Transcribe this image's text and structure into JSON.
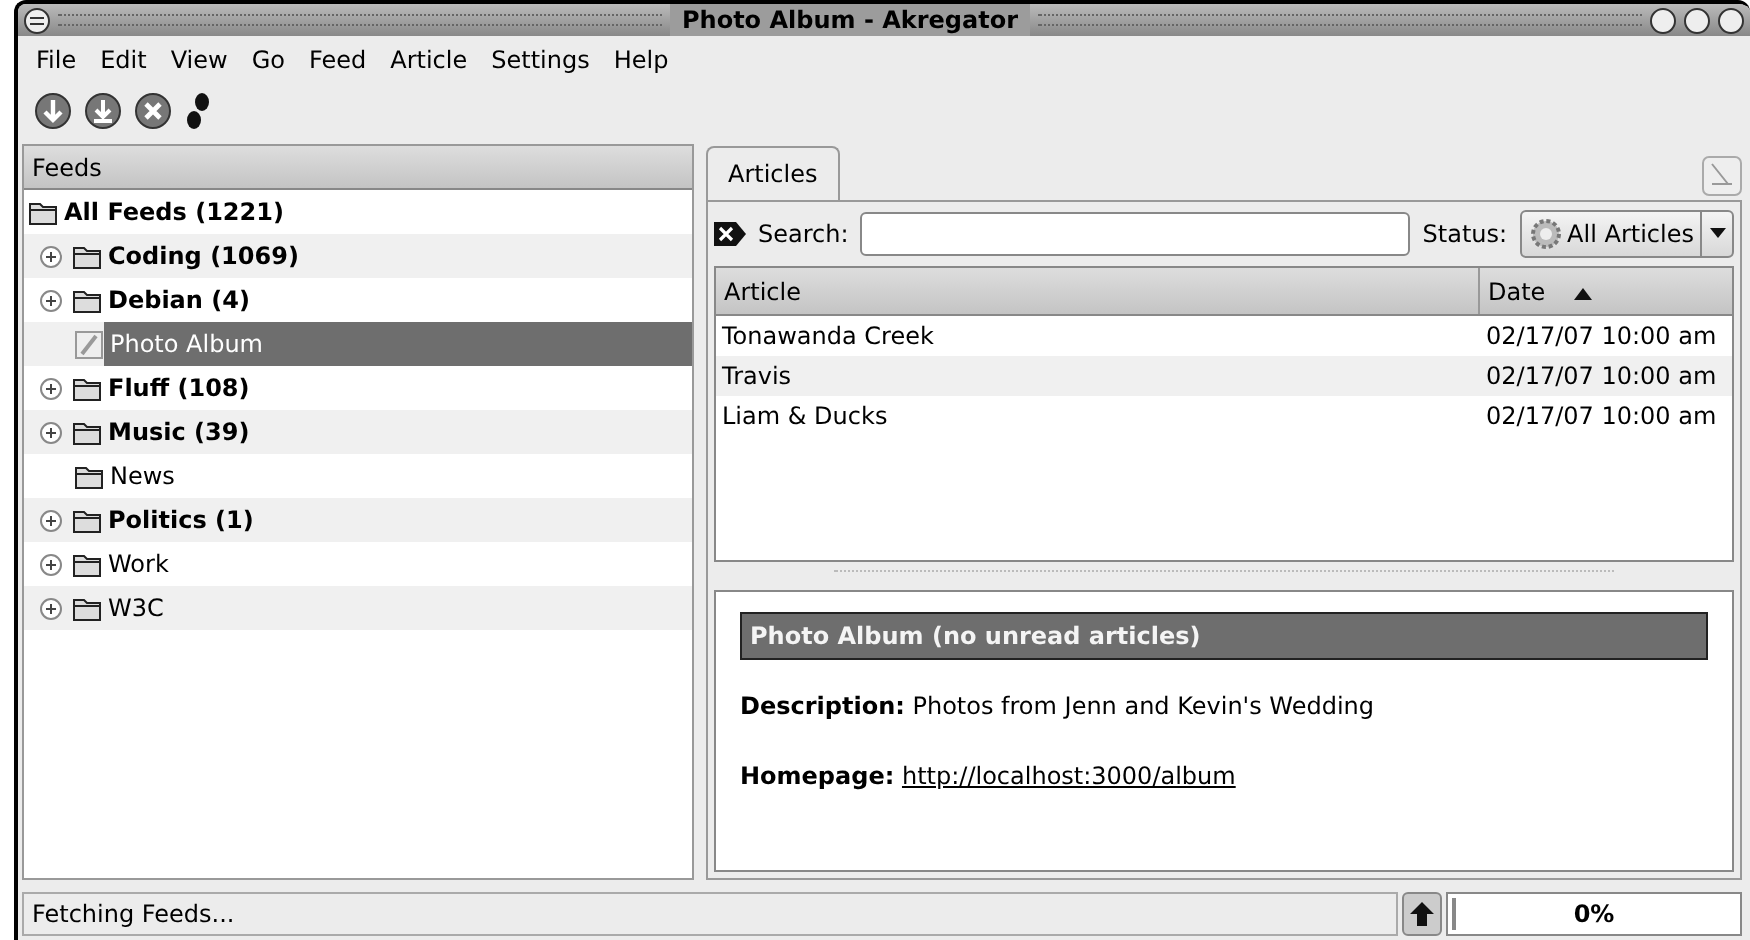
{
  "window": {
    "title": "Photo Album - Akregator"
  },
  "menu": [
    "File",
    "Edit",
    "View",
    "Go",
    "Feed",
    "Article",
    "Settings",
    "Help"
  ],
  "feeds": {
    "title": "Feeds",
    "tree": {
      "label": "All Feeds (1221)",
      "kind": "folder",
      "bold": true,
      "selected": false,
      "children": [
        {
          "label": "Coding (1069)",
          "kind": "folder",
          "bold": true,
          "expandable": true,
          "selected": false
        },
        {
          "label": "Debian (4)",
          "kind": "folder",
          "bold": true,
          "expandable": true,
          "selected": false
        },
        {
          "label": "Photo Album",
          "kind": "feed",
          "bold": false,
          "expandable": false,
          "selected": true
        },
        {
          "label": "Fluff (108)",
          "kind": "folder",
          "bold": true,
          "expandable": true,
          "selected": false
        },
        {
          "label": "Music (39)",
          "kind": "folder",
          "bold": true,
          "expandable": true,
          "selected": false
        },
        {
          "label": "News",
          "kind": "folder",
          "bold": false,
          "expandable": false,
          "selected": false
        },
        {
          "label": "Politics (1)",
          "kind": "folder",
          "bold": true,
          "expandable": true,
          "selected": false
        },
        {
          "label": "Work",
          "kind": "folder",
          "bold": false,
          "expandable": true,
          "selected": false
        },
        {
          "label": "W3C",
          "kind": "folder",
          "bold": false,
          "expandable": true,
          "selected": false
        }
      ]
    }
  },
  "tabs": [
    {
      "label": "Articles",
      "selected": true
    }
  ],
  "search": {
    "label": "Search:",
    "status_label": "Status:",
    "status_value": "All Articles"
  },
  "table": {
    "columns": [
      {
        "label": "Article",
        "sorted": false
      },
      {
        "label": "Date",
        "sorted": true
      }
    ],
    "rows": [
      [
        "Tonawanda Creek",
        "02/17/07 10:00 am"
      ],
      [
        "Travis",
        "02/17/07 10:00 am"
      ],
      [
        "Liam & Ducks",
        "02/17/07 10:00 am"
      ]
    ]
  },
  "preview": {
    "header": "Photo Album (no unread articles)",
    "description_label": "Description:",
    "description": "Photos from Jenn and Kevin's Wedding",
    "homepage_label": "Homepage:",
    "homepage": "http://localhost:3000/album"
  },
  "status_bar": {
    "text": "Fetching Feeds...",
    "level": 0,
    "reading": "0%"
  }
}
